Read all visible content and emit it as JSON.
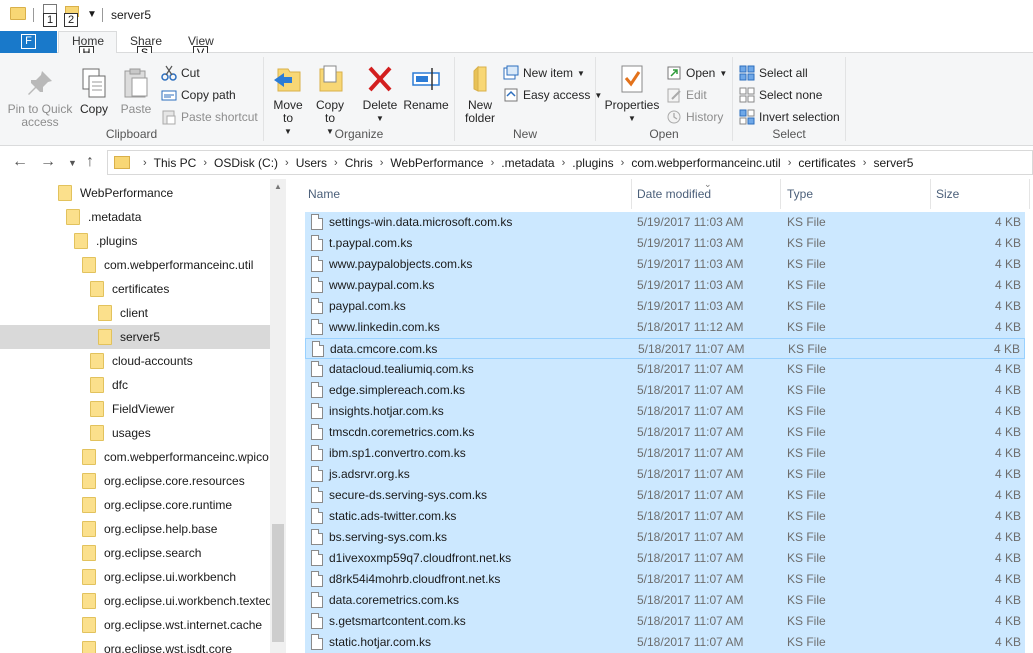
{
  "window": {
    "title": "server5",
    "qa_keytips": [
      "1",
      "2"
    ]
  },
  "ribbon_tabs": {
    "file": {
      "label": "F"
    },
    "home": {
      "label": "Home",
      "keytip": "H"
    },
    "share": {
      "label": "Share",
      "keytip": "S"
    },
    "view": {
      "label": "View",
      "keytip": "V"
    }
  },
  "clipboard": {
    "label": "Clipboard",
    "pin_label": "Pin to Quick access",
    "copy_label": "Copy",
    "paste_label": "Paste",
    "cut_label": "Cut",
    "copy_path_label": "Copy path",
    "paste_shortcut_label": "Paste shortcut"
  },
  "organize": {
    "label": "Organize",
    "move_to_label": "Move to",
    "copy_to_label": "Copy to",
    "delete_label": "Delete",
    "rename_label": "Rename"
  },
  "new_group": {
    "label": "New",
    "new_folder_label": "New folder",
    "new_item_label": "New item",
    "easy_access_label": "Easy access"
  },
  "open_group": {
    "label": "Open",
    "properties_label": "Properties",
    "open_label": "Open",
    "edit_label": "Edit",
    "history_label": "History"
  },
  "select_group": {
    "label": "Select",
    "select_all_label": "Select all",
    "select_none_label": "Select none",
    "invert_label": "Invert selection"
  },
  "colors": {
    "file_tab": "#1979ca",
    "selection": "#cce8ff",
    "selection_border": "#99d1ff",
    "folder": "#f8d775"
  },
  "breadcrumb": [
    "This PC",
    "OSDisk (C:)",
    "Users",
    "Chris",
    "WebPerformance",
    ".metadata",
    ".plugins",
    "com.webperformanceinc.util",
    "certificates",
    "server5"
  ],
  "tree": [
    {
      "label": "WebPerformance",
      "indent": 0
    },
    {
      "label": ".metadata",
      "indent": 1
    },
    {
      "label": ".plugins",
      "indent": 2
    },
    {
      "label": "com.webperformanceinc.util",
      "indent": 3
    },
    {
      "label": "certificates",
      "indent": 4
    },
    {
      "label": "client",
      "indent": 5
    },
    {
      "label": "server5",
      "indent": 5,
      "selected": true
    },
    {
      "label": "cloud-accounts",
      "indent": 4
    },
    {
      "label": "dfc",
      "indent": 4
    },
    {
      "label": "FieldViewer",
      "indent": 4
    },
    {
      "label": "usages",
      "indent": 4
    },
    {
      "label": "com.webperformanceinc.wpico",
      "indent": 3
    },
    {
      "label": "org.eclipse.core.resources",
      "indent": 3
    },
    {
      "label": "org.eclipse.core.runtime",
      "indent": 3
    },
    {
      "label": "org.eclipse.help.base",
      "indent": 3
    },
    {
      "label": "org.eclipse.search",
      "indent": 3
    },
    {
      "label": "org.eclipse.ui.workbench",
      "indent": 3
    },
    {
      "label": "org.eclipse.ui.workbench.texted",
      "indent": 3
    },
    {
      "label": "org.eclipse.wst.internet.cache",
      "indent": 3
    },
    {
      "label": "org.eclipse.wst.isdt.core",
      "indent": 3
    }
  ],
  "columns": {
    "name": "Name",
    "date": "Date modified",
    "type": "Type",
    "size": "Size"
  },
  "files": [
    {
      "name": "settings-win.data.microsoft.com.ks",
      "date": "5/19/2017 11:03 AM",
      "type": "KS File",
      "size": "4 KB"
    },
    {
      "name": "t.paypal.com.ks",
      "date": "5/19/2017 11:03 AM",
      "type": "KS File",
      "size": "4 KB"
    },
    {
      "name": "www.paypalobjects.com.ks",
      "date": "5/19/2017 11:03 AM",
      "type": "KS File",
      "size": "4 KB"
    },
    {
      "name": "www.paypal.com.ks",
      "date": "5/19/2017 11:03 AM",
      "type": "KS File",
      "size": "4 KB"
    },
    {
      "name": "paypal.com.ks",
      "date": "5/19/2017 11:03 AM",
      "type": "KS File",
      "size": "4 KB"
    },
    {
      "name": "www.linkedin.com.ks",
      "date": "5/18/2017 11:12 AM",
      "type": "KS File",
      "size": "4 KB"
    },
    {
      "name": "data.cmcore.com.ks",
      "date": "5/18/2017 11:07 AM",
      "type": "KS File",
      "size": "4 KB",
      "focused": true
    },
    {
      "name": "datacloud.tealiumiq.com.ks",
      "date": "5/18/2017 11:07 AM",
      "type": "KS File",
      "size": "4 KB"
    },
    {
      "name": "edge.simplereach.com.ks",
      "date": "5/18/2017 11:07 AM",
      "type": "KS File",
      "size": "4 KB"
    },
    {
      "name": "insights.hotjar.com.ks",
      "date": "5/18/2017 11:07 AM",
      "type": "KS File",
      "size": "4 KB"
    },
    {
      "name": "tmscdn.coremetrics.com.ks",
      "date": "5/18/2017 11:07 AM",
      "type": "KS File",
      "size": "4 KB"
    },
    {
      "name": "ibm.sp1.convertro.com.ks",
      "date": "5/18/2017 11:07 AM",
      "type": "KS File",
      "size": "4 KB"
    },
    {
      "name": "js.adsrvr.org.ks",
      "date": "5/18/2017 11:07 AM",
      "type": "KS File",
      "size": "4 KB"
    },
    {
      "name": "secure-ds.serving-sys.com.ks",
      "date": "5/18/2017 11:07 AM",
      "type": "KS File",
      "size": "4 KB"
    },
    {
      "name": "static.ads-twitter.com.ks",
      "date": "5/18/2017 11:07 AM",
      "type": "KS File",
      "size": "4 KB"
    },
    {
      "name": "bs.serving-sys.com.ks",
      "date": "5/18/2017 11:07 AM",
      "type": "KS File",
      "size": "4 KB"
    },
    {
      "name": "d1ivexoxmp59q7.cloudfront.net.ks",
      "date": "5/18/2017 11:07 AM",
      "type": "KS File",
      "size": "4 KB"
    },
    {
      "name": "d8rk54i4mohrb.cloudfront.net.ks",
      "date": "5/18/2017 11:07 AM",
      "type": "KS File",
      "size": "4 KB"
    },
    {
      "name": "data.coremetrics.com.ks",
      "date": "5/18/2017 11:07 AM",
      "type": "KS File",
      "size": "4 KB"
    },
    {
      "name": "s.getsmartcontent.com.ks",
      "date": "5/18/2017 11:07 AM",
      "type": "KS File",
      "size": "4 KB"
    },
    {
      "name": "static.hotjar.com.ks",
      "date": "5/18/2017 11:07 AM",
      "type": "KS File",
      "size": "4 KB"
    }
  ]
}
